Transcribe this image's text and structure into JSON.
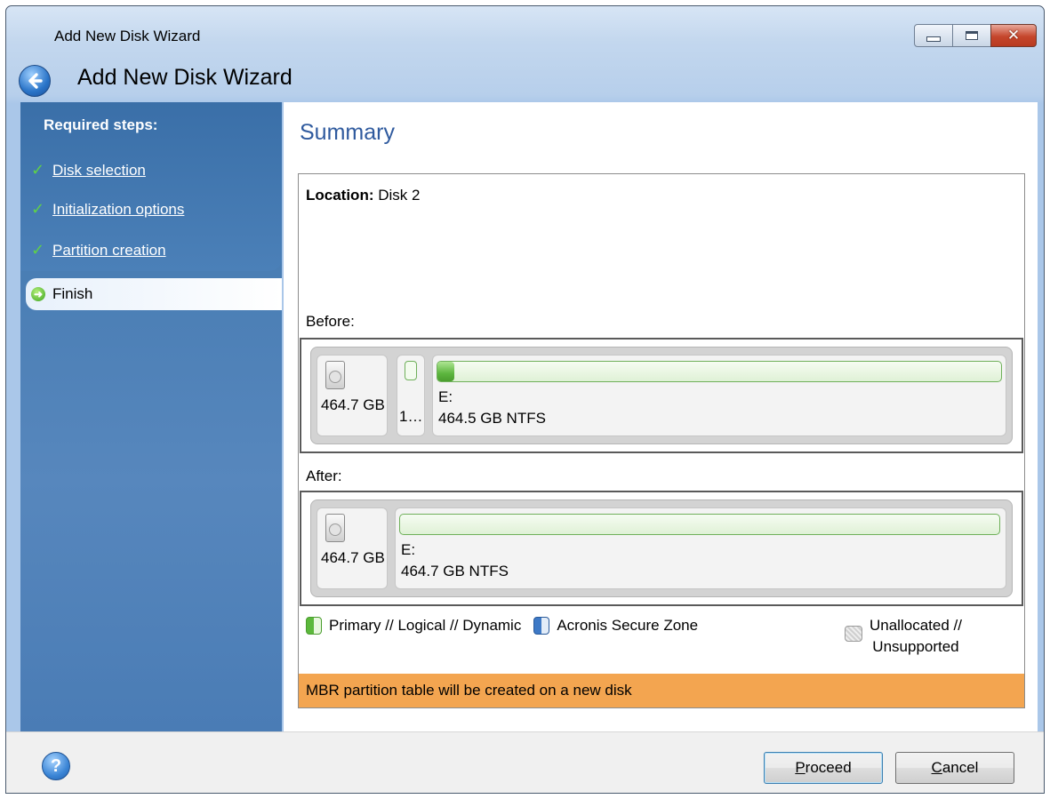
{
  "window": {
    "title": "Add New Disk Wizard",
    "wizard_title": "Add New Disk Wizard",
    "close_glyph": "✕"
  },
  "sidebar": {
    "heading": "Required steps:",
    "steps": [
      {
        "label": "Disk selection",
        "done": true
      },
      {
        "label": "Initialization options",
        "done": true
      },
      {
        "label": "Partition creation",
        "done": true
      }
    ],
    "current": {
      "label": "Finish"
    },
    "check_glyph": "✓",
    "arrow_glyph": "➜"
  },
  "summary": {
    "title": "Summary",
    "location_label": "Location:",
    "location_value": "Disk 2",
    "before_label": "Before:",
    "after_label": "After:",
    "before": {
      "disk_size": "464.7 GB",
      "small_partition_label": "1…",
      "partition_letter": "E:",
      "partition_info": "464.5 GB  NTFS",
      "used_fraction": 0.03
    },
    "after": {
      "disk_size": "464.7 GB",
      "partition_letter": "E:",
      "partition_info": "464.7 GB  NTFS"
    },
    "legend": {
      "primary": "Primary // Logical // Dynamic",
      "secure_zone": "Acronis Secure Zone",
      "unallocated_line1": "Unallocated //",
      "unallocated_line2": "Unsupported"
    },
    "notice": "MBR partition table will be created on a new disk",
    "notice_color": "#f3a550"
  },
  "buttons": {
    "help_glyph": "?",
    "proceed_first": "P",
    "proceed_rest": "roceed",
    "cancel_first": "C",
    "cancel_rest": "ancel"
  }
}
